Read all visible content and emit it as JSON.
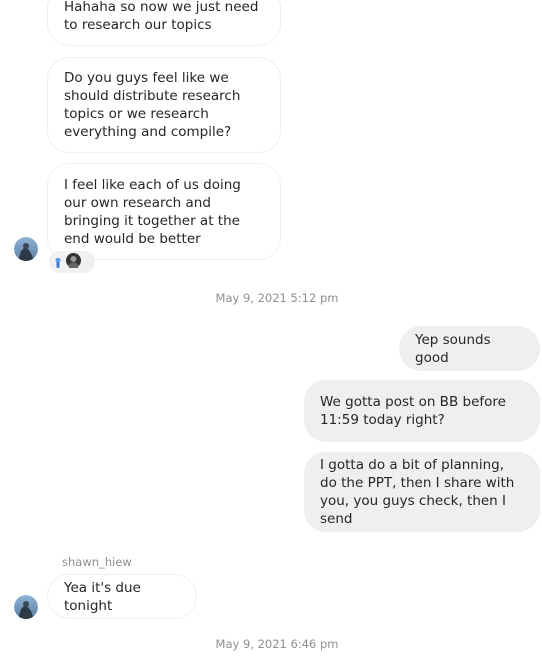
{
  "messages": [
    {
      "text": "Hahaha so now we just need to research our topics",
      "side": "incoming"
    },
    {
      "text": "Do you guys feel like we should distribute research topics or we research everything and compile?",
      "side": "incoming"
    },
    {
      "text": "I feel like each of us doing our own research and bringing it together at the end would be better",
      "side": "incoming"
    },
    {
      "text": "Yep sounds good",
      "side": "outgoing"
    },
    {
      "text": "We gotta post on BB before 11:59 today right?",
      "side": "outgoing"
    },
    {
      "text": "I gotta do a bit of planning, do the PPT, then I share with you, you guys check, then I send",
      "side": "outgoing"
    },
    {
      "text": "Yea it's due tonight",
      "side": "incoming"
    }
  ],
  "timestamps": [
    "May 9, 2021 5:12 pm",
    "May 9, 2021 6:46 pm"
  ],
  "sender_name": "shawn_hiew",
  "icons": {
    "avatar": "avatar-icon",
    "reaction": "thumbs-up-icon"
  },
  "colors": {
    "incoming_bg": "#ffffff",
    "incoming_border": "#efefef",
    "outgoing_bg": "#efefef",
    "meta_text": "#8e8e8e",
    "reaction_accent": "#3a7bd5"
  }
}
